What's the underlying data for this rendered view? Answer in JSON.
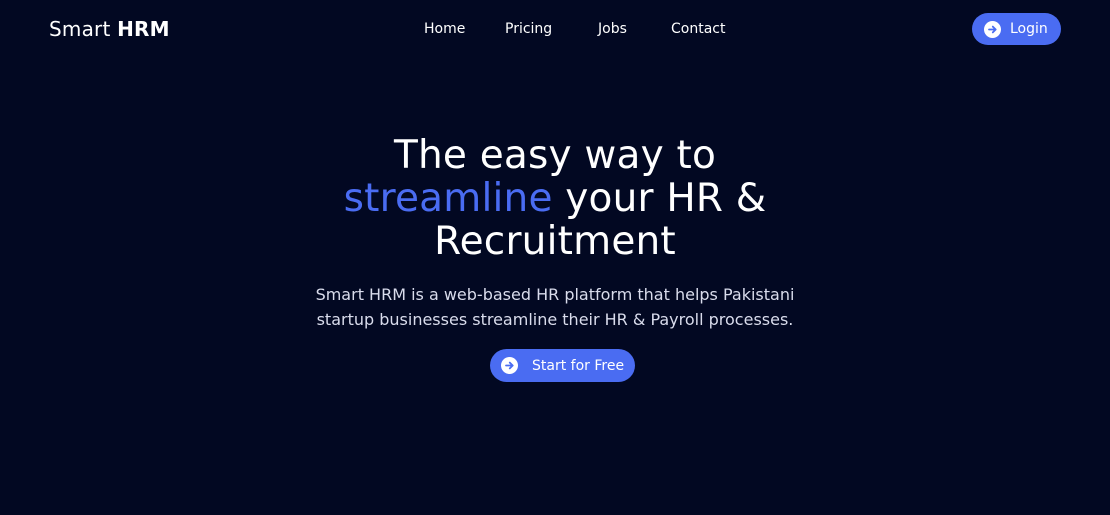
{
  "brand": {
    "name_regular": "Smart ",
    "name_bold": "HRM"
  },
  "nav": {
    "links": [
      "Home",
      "Pricing",
      "Jobs",
      "Contact"
    ],
    "login_label": "Login",
    "login_icon": "arrow-right-circle-icon"
  },
  "hero": {
    "title_line1": "The easy way to",
    "title_highlight": "streamline",
    "title_line2_rest": " your HR &",
    "title_line3": "Recruitment",
    "subtitle_line1": "Smart HRM is a web-based HR platform that helps Pakistani",
    "subtitle_line2": "startup businesses streamline their HR & Payroll processes.",
    "cta_label": "Start for Free",
    "cta_icon": "arrow-right-circle-icon"
  },
  "colors": {
    "background": "#020822",
    "accent": "#4a6cf2",
    "text": "#ffffff",
    "subtitle_text": "#d9dcec"
  }
}
